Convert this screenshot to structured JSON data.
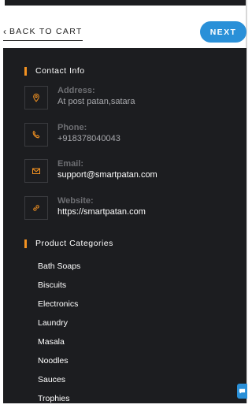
{
  "nav": {
    "back_label": "BACK TO CART",
    "back_icon": "chevron-left-icon",
    "next_label": "NEXT"
  },
  "contact": {
    "heading": "Contact Info",
    "address": {
      "label": "Address:",
      "value": "At post patan,satara",
      "icon": "map-pin-icon"
    },
    "phone": {
      "label": "Phone:",
      "value": "+918378040043",
      "icon": "phone-icon"
    },
    "email": {
      "label": "Email:",
      "value": "support@smartpatan.com",
      "icon": "mail-icon"
    },
    "website": {
      "label": "Website:",
      "value": "https://smartpatan.com",
      "icon": "link-icon"
    }
  },
  "categories": {
    "heading": "Product Categories",
    "items": [
      "Bath Soaps",
      "Biscuits",
      "Electronics",
      "Laundry",
      "Masala",
      "Noodles",
      "Sauces",
      "Trophies"
    ]
  },
  "colors": {
    "panel": "#1c1d20",
    "accent": "#f39221",
    "button": "#2a90d8"
  },
  "chat": {
    "icon": "chat-icon"
  }
}
